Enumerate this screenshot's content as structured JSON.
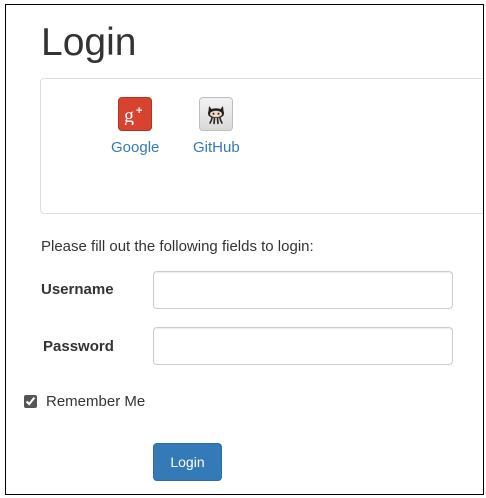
{
  "page": {
    "title": "Login"
  },
  "auth_clients": [
    {
      "label": "Google",
      "icon": "google-plus-icon",
      "color": "#d8432f"
    },
    {
      "label": "GitHub",
      "icon": "github-octocat-icon",
      "color": "#333333"
    }
  ],
  "form": {
    "instructions": "Please fill out the following fields to login:",
    "username": {
      "label": "Username",
      "value": "",
      "placeholder": ""
    },
    "password": {
      "label": "Password",
      "value": "",
      "placeholder": ""
    },
    "remember_me": {
      "label": "Remember Me",
      "checked": true
    },
    "submit_label": "Login"
  },
  "colors": {
    "link": "#337ab7",
    "primary_button": "#337ab7",
    "text": "#333333"
  }
}
